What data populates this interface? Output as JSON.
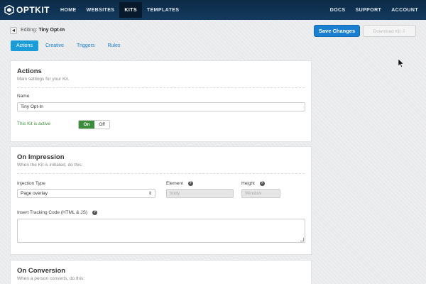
{
  "brand": {
    "name": "OPTKIT"
  },
  "nav": {
    "left": [
      {
        "label": "HOME",
        "active": false
      },
      {
        "label": "WEBSITES",
        "active": false
      },
      {
        "label": "KITS",
        "active": true
      },
      {
        "label": "TEMPLATES",
        "active": false
      }
    ],
    "right": [
      "DOCS",
      "SUPPORT",
      "ACCOUNT"
    ]
  },
  "header": {
    "back_glyph": "◂",
    "editing_prefix": "Editing:",
    "kit_name": "Tiny Opt-In",
    "save_label": "Save Changes",
    "secondary_label": "Download Kit ⇩"
  },
  "tabs": [
    {
      "label": "Actions",
      "active": true
    },
    {
      "label": "Creative",
      "active": false
    },
    {
      "label": "Triggers",
      "active": false
    },
    {
      "label": "Rules",
      "active": false
    }
  ],
  "actions_card": {
    "title": "Actions",
    "subtitle": "Main settings for your Kit.",
    "name_label": "Name",
    "name_value": "Tiny Opt-In",
    "active_label": "This Kit is active",
    "toggle_on": "On",
    "toggle_off": "Off"
  },
  "impression_card": {
    "title": "On Impression",
    "subtitle": "When the Kit is initiated, do this:",
    "injection_label": "Injection Type",
    "injection_value": "Page overlay",
    "element_label": "Element",
    "element_value": "body",
    "height_label": "Height",
    "height_value": "Window",
    "tracking_label": "Insert Tracking Code (HTML & JS)",
    "help_glyph": "?"
  },
  "conversion_card": {
    "title": "On Conversion",
    "subtitle": "When a person converts, do this:"
  },
  "colors": {
    "nav_bg": "#0c2b47",
    "primary": "#1a7fd0",
    "tab_active": "#1a9cd8",
    "success": "#3a8e3a"
  }
}
